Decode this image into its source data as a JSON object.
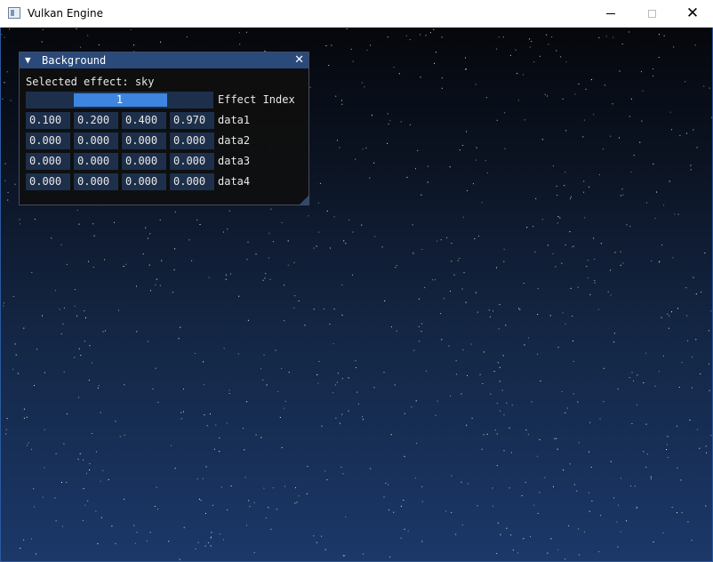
{
  "window": {
    "title": "Vulkan Engine",
    "controls": {
      "minimize": "minimize",
      "maximize": "maximize",
      "close": "✕"
    }
  },
  "panel": {
    "title": "Background",
    "selected_effect_text": "Selected effect: sky",
    "effect_index": {
      "value": "1",
      "label": "Effect Index",
      "fraction": 0.5
    },
    "rows": [
      {
        "label": "data1",
        "values": [
          "0.100",
          "0.200",
          "0.400",
          "0.970"
        ]
      },
      {
        "label": "data2",
        "values": [
          "0.000",
          "0.000",
          "0.000",
          "0.000"
        ]
      },
      {
        "label": "data3",
        "values": [
          "0.000",
          "0.000",
          "0.000",
          "0.000"
        ]
      },
      {
        "label": "data4",
        "values": [
          "0.000",
          "0.000",
          "0.000",
          "0.000"
        ]
      }
    ]
  },
  "colors": {
    "imgui_title": "#294a7a",
    "frame_bg": "#1d2f4a",
    "slider_grab": "#3d85e0",
    "sky_top": "#05070c",
    "sky_bottom": "#1b3869"
  }
}
